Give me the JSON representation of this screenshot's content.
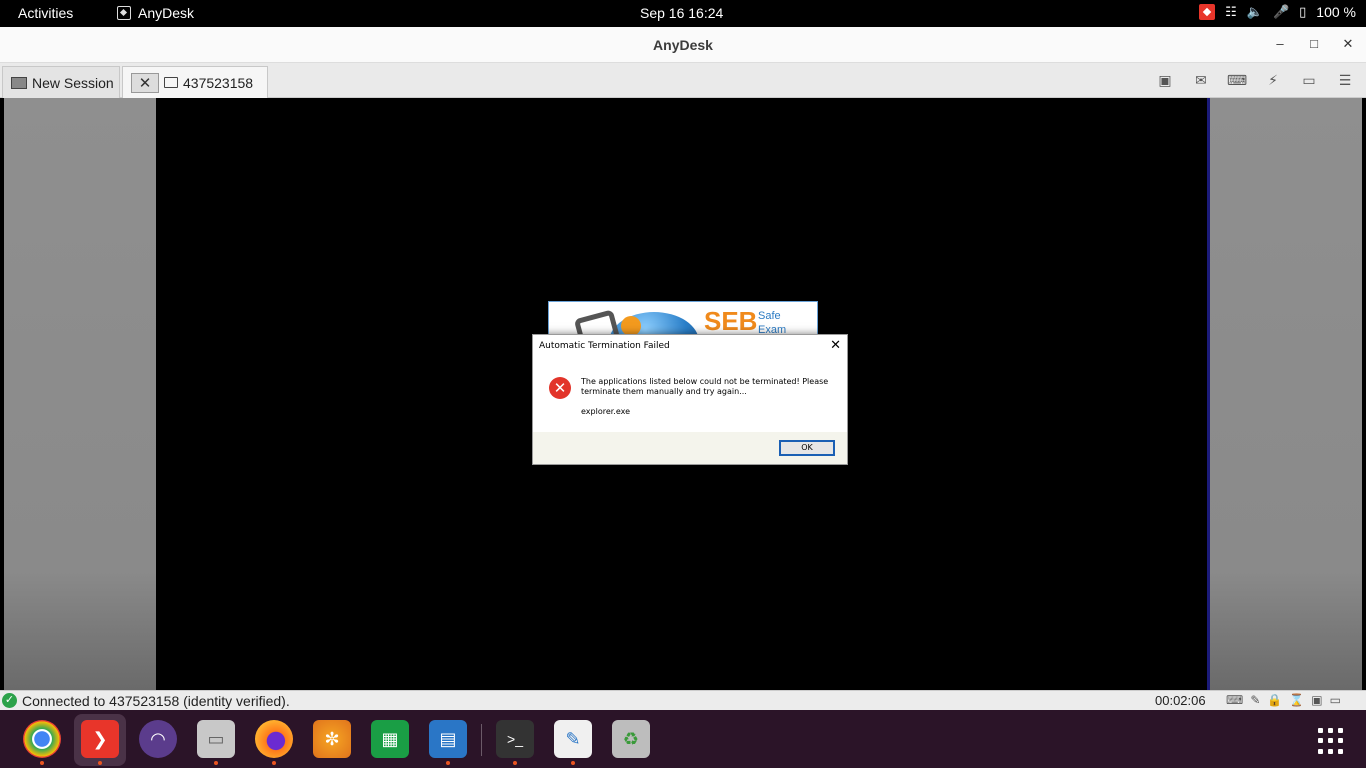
{
  "topbar": {
    "activities": "Activities",
    "app_name": "AnyDesk",
    "clock": "Sep 16  16:24",
    "battery": "100 %"
  },
  "window": {
    "title": "AnyDesk"
  },
  "tabs": {
    "new_session": "New Session",
    "session_id": "437523158"
  },
  "splash": {
    "logo": "SEB",
    "line1": "Safe",
    "line2": "Exam"
  },
  "dialog": {
    "title": "Automatic Termination Failed",
    "message": "The applications listed below could not be terminated! Please terminate them manually and try again...",
    "process": "explorer.exe",
    "ok_label": "OK"
  },
  "status": {
    "text": "Connected to 437523158 (identity verified).",
    "timer": "00:02:06"
  },
  "colors": {
    "anydesk_red": "#e8352a",
    "dock_bg": "#2b1428",
    "connected_green": "#2ca24a"
  }
}
